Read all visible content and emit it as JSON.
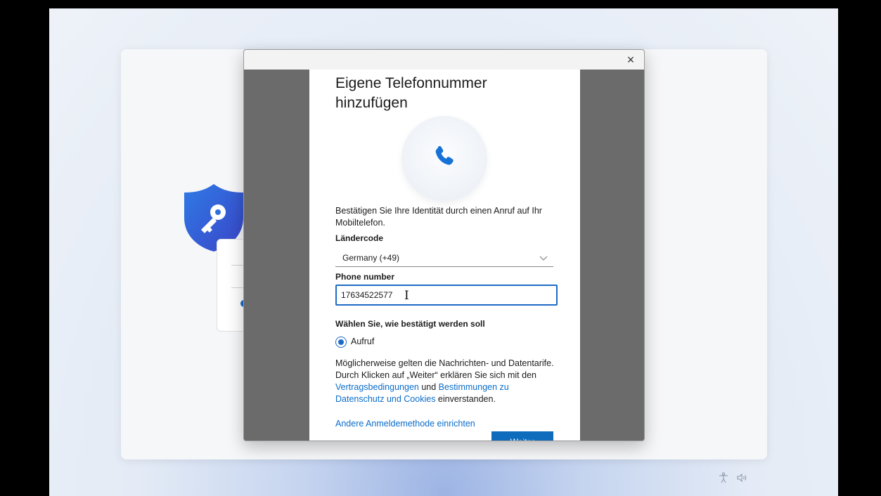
{
  "dialog": {
    "close_glyph": "×",
    "title": "Eigene Telefonnummer hinzufügen",
    "description": "Bestätigen Sie Ihre Identität durch einen Anruf auf Ihr Mobiltelefon.",
    "country_label": "Ländercode",
    "country_value": "Germany (+49)",
    "phone_label": "Phone number",
    "phone_value": "17634522577",
    "method_heading": "Wählen Sie, wie bestätigt werden soll",
    "method_option": "Aufruf",
    "legal_text_1": "Möglicherweise gelten die Nachrichten- und Datentarife. Durch Klicken auf „Weiter“ erklären Sie sich mit den ",
    "legal_link_terms": "Vertragsbedingungen",
    "legal_text_2": " und ",
    "legal_link_privacy": "Bestimmungen zu Datenschutz und Cookies",
    "legal_text_3": " einverstanden.",
    "alt_method_link": "Andere Anmeldemethode einrichten",
    "next_button": "Weiter"
  },
  "icons": [
    "close-icon",
    "phone-icon",
    "shield-key-icon",
    "chevron-down-icon",
    "text-cursor-icon",
    "accessibility-icon",
    "volume-icon"
  ],
  "colors": {
    "accent": "#0f6cbd",
    "link": "#0a6cc9",
    "overlay": "#6b6b6b",
    "shield": "#2a6fd6"
  }
}
